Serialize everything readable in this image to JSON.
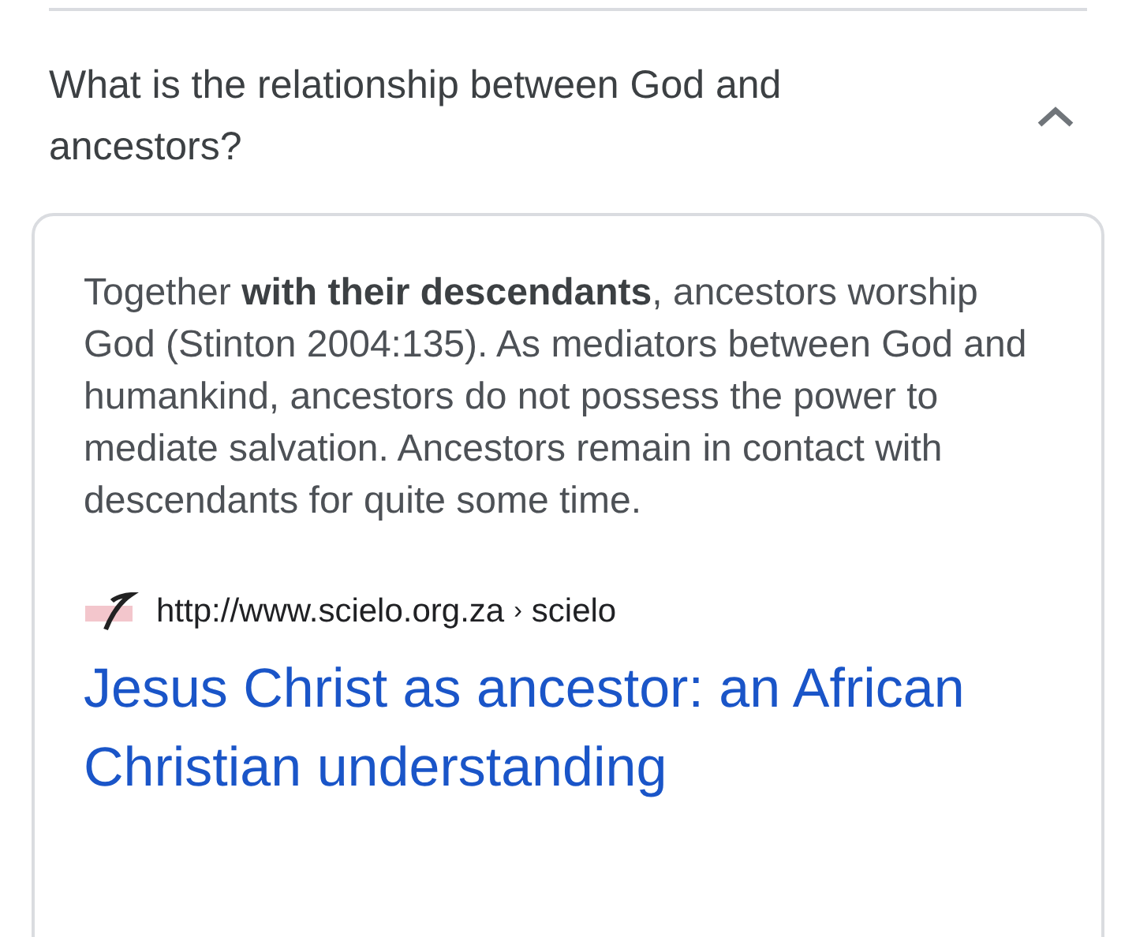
{
  "question": {
    "text": "What is the relationship between God and ancestors?",
    "expanded": true
  },
  "answer": {
    "snippet": "Together **with their descendants**, ancestors worship God (Stinton 2004:135). As mediators between God and humankind, ancestors do not possess the power to mediate salvation. Ancestors remain in contact with descendants for quite some time.",
    "source_url": "http://www.scielo.org.za",
    "breadcrumb_separator": "›",
    "breadcrumb": "scielo",
    "title": "Jesus Christ as ancestor: an African Christian understanding"
  }
}
